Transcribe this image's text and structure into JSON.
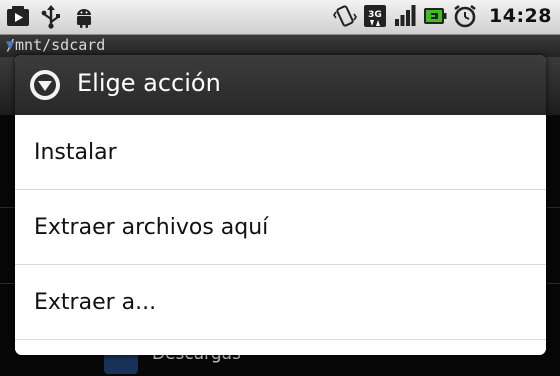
{
  "status_bar": {
    "left_icons": [
      "youtube-icon",
      "usb-icon",
      "android-icon"
    ],
    "right_icons": [
      "vibrate-icon",
      "3g-data-icon",
      "signal-icon",
      "battery-charging-icon",
      "alarm-icon"
    ],
    "network_label": "3G",
    "time": "14:28"
  },
  "background": {
    "path": "/mnt/sdcard",
    "bottom_item_text": "Descargas"
  },
  "dialog": {
    "title": "Elige acción",
    "title_icon": "chevron-down-circle-icon",
    "items": [
      {
        "label": "Instalar"
      },
      {
        "label": "Extraer archivos aquí"
      },
      {
        "label": "Extraer a..."
      }
    ]
  },
  "colors": {
    "dialog_title_bg": "#2e2e2e",
    "dialog_body_bg": "#ffffff",
    "divider": "#d9d9d9",
    "battery_green": "#3fbf1f"
  }
}
